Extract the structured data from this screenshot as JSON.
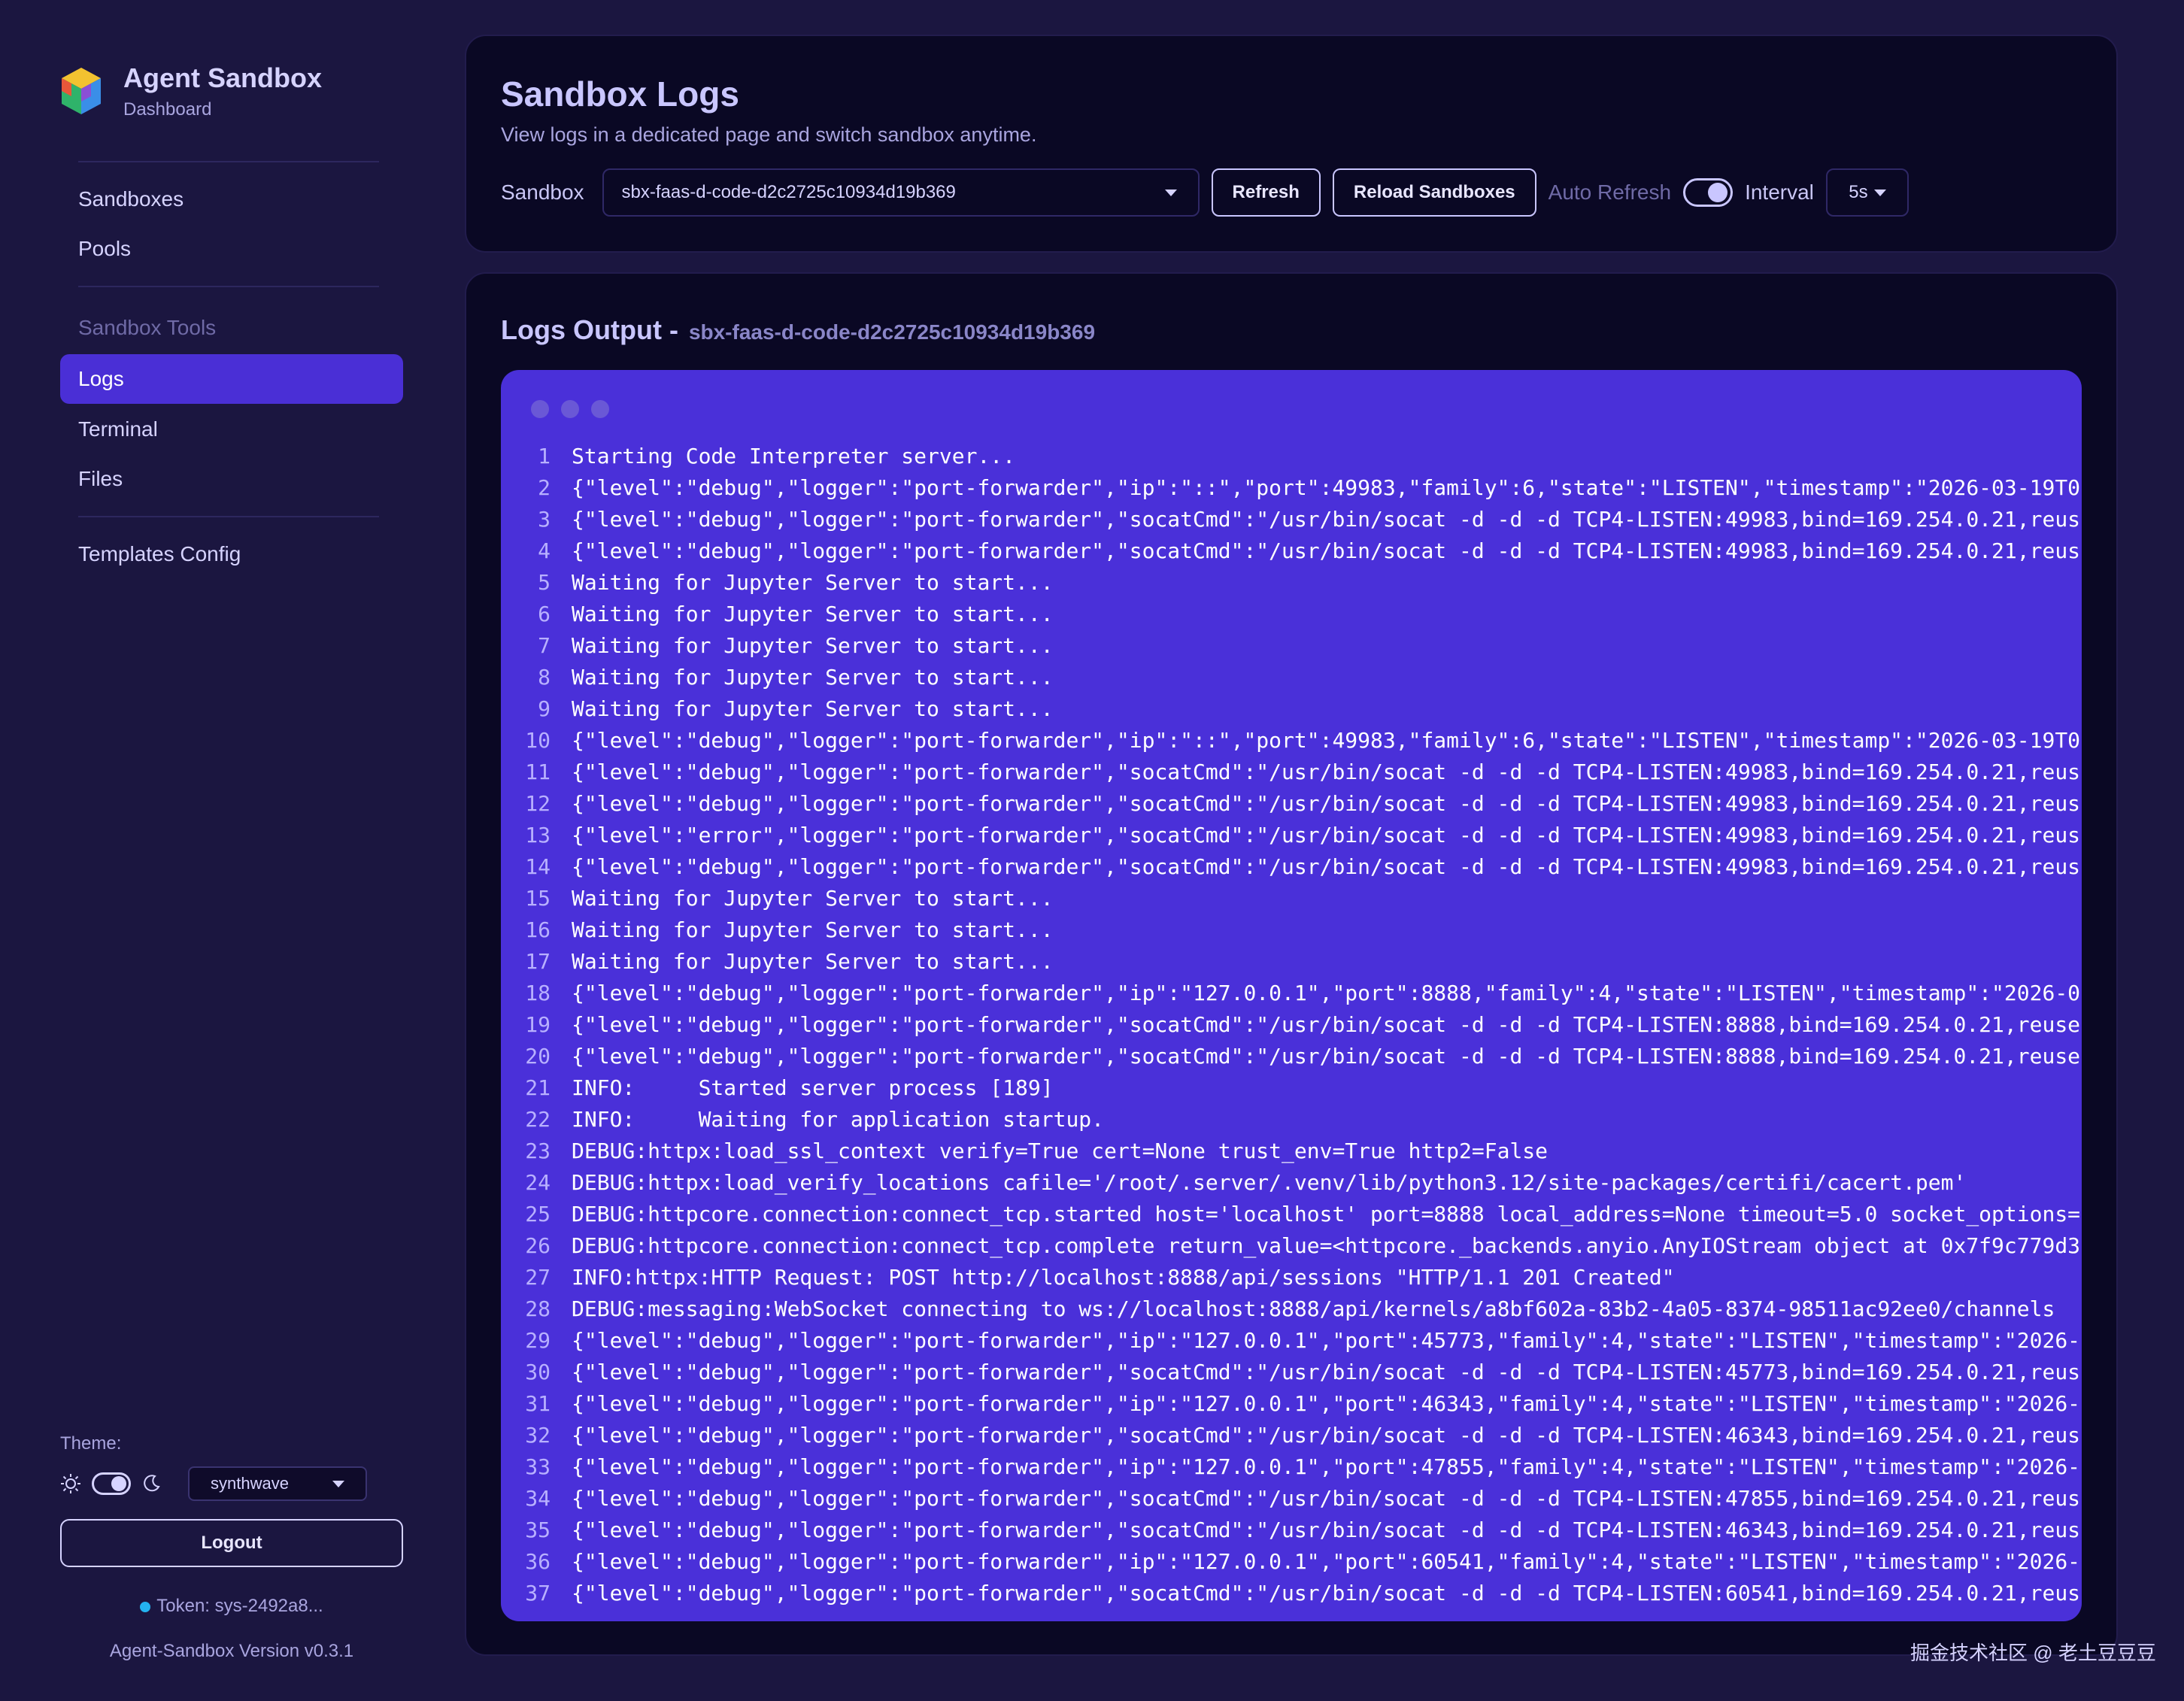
{
  "app": {
    "title": "Agent Sandbox",
    "subtitle": "Dashboard"
  },
  "sidebar": {
    "main_items": [
      {
        "label": "Sandboxes"
      },
      {
        "label": "Pools"
      }
    ],
    "tools_section": "Sandbox Tools",
    "tool_items": [
      {
        "label": "Logs",
        "active": true
      },
      {
        "label": "Terminal"
      },
      {
        "label": "Files"
      }
    ],
    "extra_items": [
      {
        "label": "Templates Config"
      }
    ],
    "theme_label": "Theme:",
    "theme_value": "synthwave",
    "logout_label": "Logout",
    "token_text": "Token: sys-2492a8...",
    "version_text": "Agent-Sandbox Version v0.3.1"
  },
  "header": {
    "title": "Sandbox Logs",
    "subtitle": "View logs in a dedicated page and switch sandbox anytime.",
    "sandbox_label": "Sandbox",
    "sandbox_value": "sbx-faas-d-code-d2c2725c10934d19b369",
    "refresh_label": "Refresh",
    "reload_label": "Reload Sandboxes",
    "auto_refresh_label": "Auto Refresh",
    "auto_refresh_on": true,
    "interval_label": "Interval",
    "interval_value": "5s"
  },
  "logs": {
    "title": "Logs Output -",
    "sandbox_id": "sbx-faas-d-code-d2c2725c10934d19b369",
    "lines": [
      "Starting Code Interpreter server...",
      "{\"level\":\"debug\",\"logger\":\"port-forwarder\",\"ip\":\"::\",\"port\":49983,\"family\":6,\"state\":\"LISTEN\",\"timestamp\":\"2026-03-19T0",
      "{\"level\":\"debug\",\"logger\":\"port-forwarder\",\"socatCmd\":\"/usr/bin/socat -d -d -d TCP4-LISTEN:49983,bind=169.254.0.21,reus",
      "{\"level\":\"debug\",\"logger\":\"port-forwarder\",\"socatCmd\":\"/usr/bin/socat -d -d -d TCP4-LISTEN:49983,bind=169.254.0.21,reus",
      "Waiting for Jupyter Server to start...",
      "Waiting for Jupyter Server to start...",
      "Waiting for Jupyter Server to start...",
      "Waiting for Jupyter Server to start...",
      "Waiting for Jupyter Server to start...",
      "{\"level\":\"debug\",\"logger\":\"port-forwarder\",\"ip\":\"::\",\"port\":49983,\"family\":6,\"state\":\"LISTEN\",\"timestamp\":\"2026-03-19T0",
      "{\"level\":\"debug\",\"logger\":\"port-forwarder\",\"socatCmd\":\"/usr/bin/socat -d -d -d TCP4-LISTEN:49983,bind=169.254.0.21,reus",
      "{\"level\":\"debug\",\"logger\":\"port-forwarder\",\"socatCmd\":\"/usr/bin/socat -d -d -d TCP4-LISTEN:49983,bind=169.254.0.21,reus",
      "{\"level\":\"error\",\"logger\":\"port-forwarder\",\"socatCmd\":\"/usr/bin/socat -d -d -d TCP4-LISTEN:49983,bind=169.254.0.21,reus",
      "{\"level\":\"debug\",\"logger\":\"port-forwarder\",\"socatCmd\":\"/usr/bin/socat -d -d -d TCP4-LISTEN:49983,bind=169.254.0.21,reus",
      "Waiting for Jupyter Server to start...",
      "Waiting for Jupyter Server to start...",
      "Waiting for Jupyter Server to start...",
      "{\"level\":\"debug\",\"logger\":\"port-forwarder\",\"ip\":\"127.0.0.1\",\"port\":8888,\"family\":4,\"state\":\"LISTEN\",\"timestamp\":\"2026-0",
      "{\"level\":\"debug\",\"logger\":\"port-forwarder\",\"socatCmd\":\"/usr/bin/socat -d -d -d TCP4-LISTEN:8888,bind=169.254.0.21,reuse",
      "{\"level\":\"debug\",\"logger\":\"port-forwarder\",\"socatCmd\":\"/usr/bin/socat -d -d -d TCP4-LISTEN:8888,bind=169.254.0.21,reuse",
      "INFO:     Started server process [189]",
      "INFO:     Waiting for application startup.",
      "DEBUG:httpx:load_ssl_context verify=True cert=None trust_env=True http2=False",
      "DEBUG:httpx:load_verify_locations cafile='/root/.server/.venv/lib/python3.12/site-packages/certifi/cacert.pem'",
      "DEBUG:httpcore.connection:connect_tcp.started host='localhost' port=8888 local_address=None timeout=5.0 socket_options=",
      "DEBUG:httpcore.connection:connect_tcp.complete return_value=<httpcore._backends.anyio.AnyIOStream object at 0x7f9c779d3",
      "INFO:httpx:HTTP Request: POST http://localhost:8888/api/sessions \"HTTP/1.1 201 Created\"",
      "DEBUG:messaging:WebSocket connecting to ws://localhost:8888/api/kernels/a8bf602a-83b2-4a05-8374-98511ac92ee0/channels",
      "{\"level\":\"debug\",\"logger\":\"port-forwarder\",\"ip\":\"127.0.0.1\",\"port\":45773,\"family\":4,\"state\":\"LISTEN\",\"timestamp\":\"2026-",
      "{\"level\":\"debug\",\"logger\":\"port-forwarder\",\"socatCmd\":\"/usr/bin/socat -d -d -d TCP4-LISTEN:45773,bind=169.254.0.21,reus",
      "{\"level\":\"debug\",\"logger\":\"port-forwarder\",\"ip\":\"127.0.0.1\",\"port\":46343,\"family\":4,\"state\":\"LISTEN\",\"timestamp\":\"2026-",
      "{\"level\":\"debug\",\"logger\":\"port-forwarder\",\"socatCmd\":\"/usr/bin/socat -d -d -d TCP4-LISTEN:46343,bind=169.254.0.21,reus",
      "{\"level\":\"debug\",\"logger\":\"port-forwarder\",\"ip\":\"127.0.0.1\",\"port\":47855,\"family\":4,\"state\":\"LISTEN\",\"timestamp\":\"2026-",
      "{\"level\":\"debug\",\"logger\":\"port-forwarder\",\"socatCmd\":\"/usr/bin/socat -d -d -d TCP4-LISTEN:47855,bind=169.254.0.21,reus",
      "{\"level\":\"debug\",\"logger\":\"port-forwarder\",\"socatCmd\":\"/usr/bin/socat -d -d -d TCP4-LISTEN:46343,bind=169.254.0.21,reus",
      "{\"level\":\"debug\",\"logger\":\"port-forwarder\",\"ip\":\"127.0.0.1\",\"port\":60541,\"family\":4,\"state\":\"LISTEN\",\"timestamp\":\"2026-",
      "{\"level\":\"debug\",\"logger\":\"port-forwarder\",\"socatCmd\":\"/usr/bin/socat -d -d -d TCP4-LISTEN:60541,bind=169.254.0.21,reus"
    ]
  },
  "watermark": "掘金技术社区 @ 老土豆豆豆",
  "colors": {
    "accent": "#4a2fd6",
    "terminal_bg": "#4a30d9",
    "page_bg": "#1b1640",
    "card_bg": "#0a0824"
  }
}
